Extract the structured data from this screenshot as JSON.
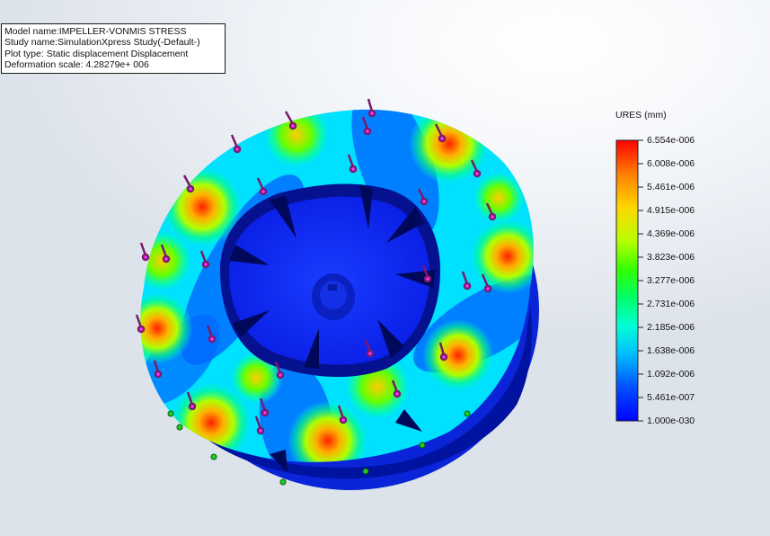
{
  "info": {
    "lines": [
      "Model name:IMPELLER-VONMIS STRESS",
      "Study name:SimulationXpress Study(-Default-)",
      "Plot type: Static displacement Displacement",
      "Deformation scale: 4.28279e+ 006"
    ]
  },
  "legend": {
    "title": "URES (mm)",
    "labels": [
      "6.554e-006",
      "6.008e-006",
      "5.461e-006",
      "4.915e-006",
      "4.369e-006",
      "3.823e-006",
      "3.277e-006",
      "2.731e-006",
      "2.185e-006",
      "1.638e-006",
      "1.092e-006",
      "5.461e-007",
      "1.000e-030"
    ],
    "colors": [
      "#ff0000",
      "#ff7f00",
      "#ffd700",
      "#b8ff00",
      "#33ff00",
      "#00ff66",
      "#00ffd5",
      "#00bfff",
      "#0050ff",
      "#0000ff"
    ]
  },
  "icons": {
    "load_arrow": "force-arrow-icon",
    "fixture": "fixture-marker-icon"
  }
}
